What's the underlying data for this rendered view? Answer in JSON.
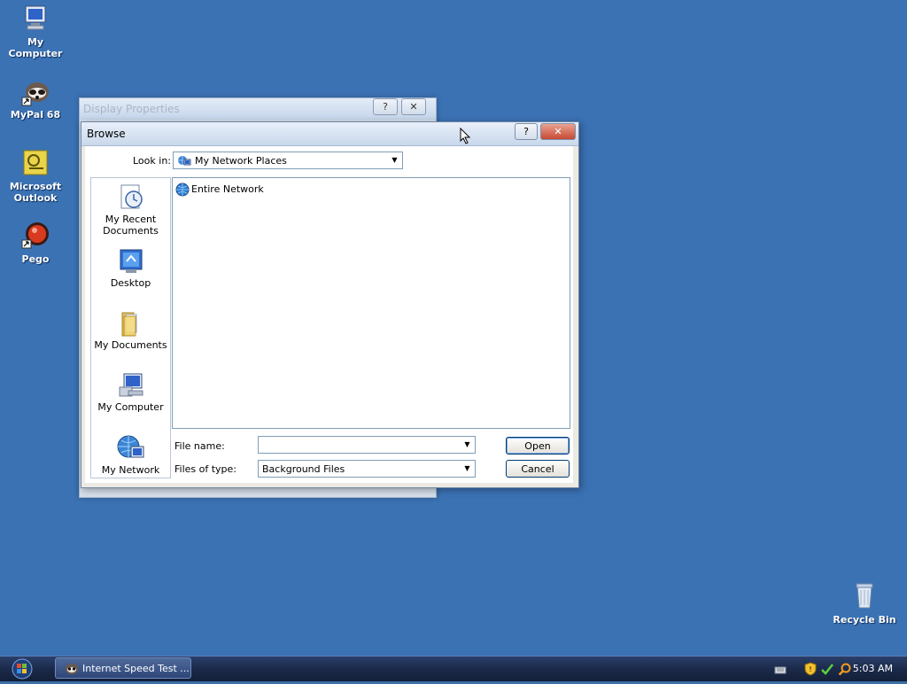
{
  "desktop": {
    "icons": [
      {
        "label": "My Computer",
        "icon": "monitor-icon"
      },
      {
        "label": "MyPal 68",
        "icon": "raccoon-icon"
      },
      {
        "label": "Microsoft Outlook",
        "icon": "outlook-icon"
      },
      {
        "label": "Pego",
        "icon": "red-orb-icon"
      },
      {
        "label": "Recycle Bin",
        "icon": "recycle-bin-icon"
      }
    ]
  },
  "background_window": {
    "title": "Display Properties",
    "help": "?",
    "close": "✕"
  },
  "dialog": {
    "title": "Browse",
    "help": "?",
    "close": "✕",
    "look_in_label": "Look in:",
    "look_in_value": "My Network Places",
    "places": [
      {
        "label": "My Recent Documents"
      },
      {
        "label": "Desktop"
      },
      {
        "label": "My Documents"
      },
      {
        "label": "My Computer"
      },
      {
        "label": "My Network"
      }
    ],
    "files": [
      {
        "name": "Entire Network",
        "icon": "globe-network-icon"
      }
    ],
    "file_name_label": "File name:",
    "file_name_value": "",
    "file_type_label": "Files of type:",
    "file_type_value": "Background Files",
    "open_label": "Open",
    "cancel_label": "Cancel"
  },
  "taskbar": {
    "task_label": "Internet Speed Test ...",
    "clock": "5:03 AM"
  },
  "colors": {
    "desktop": "#3b72b4",
    "taskbar": "#1b2a4a",
    "dialog_face": "#eceae3"
  }
}
